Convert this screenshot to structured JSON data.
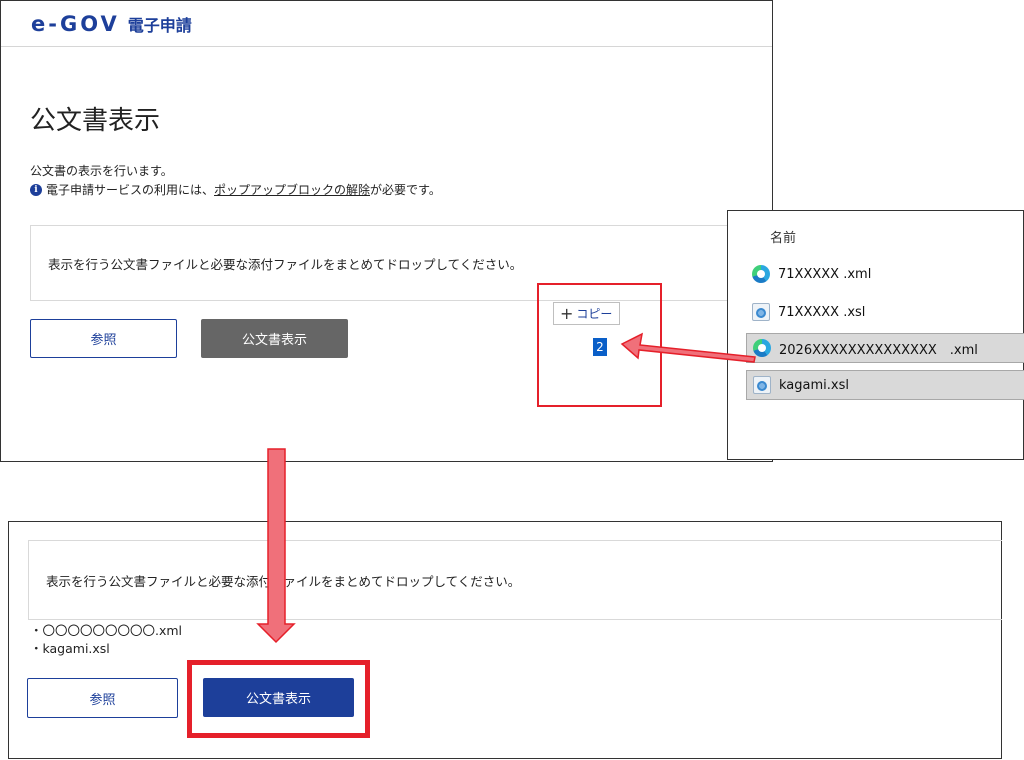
{
  "header": {
    "logo": "e-GOV",
    "service_name": "電子申請"
  },
  "page": {
    "title": "公文書表示",
    "description": "公文書の表示を行います。",
    "notice_prefix": "電子申請サービスの利用には、",
    "notice_link": "ポップアップブロックの解除",
    "notice_suffix": "が必要です。",
    "info_icon_glyph": "i"
  },
  "dropzone": {
    "instruction": "表示を行う公文書ファイルと必要な添付ファイルをまとめてドロップしてください。"
  },
  "buttons": {
    "browse_label": "参照",
    "show_label": "公文書表示",
    "show_disabled_color": "#666666",
    "show_enabled_color": "#1d3f9a"
  },
  "drag_tooltip": {
    "plus": "+",
    "label": "コピー",
    "count": "2"
  },
  "explorer": {
    "column_header": "名前",
    "files": [
      {
        "name": "71XXXXX .xml",
        "icon": "edge-icon",
        "selected": false
      },
      {
        "name": "71XXXXX .xsl",
        "icon": "xsl-icon",
        "selected": false
      },
      {
        "name": "2026XXXXXXXXXXXXXX　.xml",
        "icon": "edge-icon",
        "selected": true
      },
      {
        "name": "kagami.xsl",
        "icon": "xsl-icon",
        "selected": true
      }
    ]
  },
  "dropped_files": [
    "・〇〇〇〇〇〇〇〇〇.xml",
    "・kagami.xsl"
  ],
  "colors": {
    "brand": "#1d3f9a",
    "highlight_red": "#e5202a",
    "arrow_fill": "#f0707a"
  }
}
